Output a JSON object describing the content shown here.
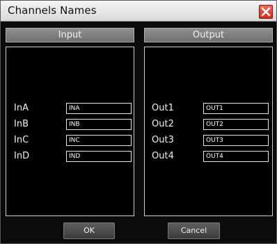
{
  "window": {
    "title": "Channels Names",
    "close_icon": "close-icon"
  },
  "input_panel": {
    "header": "Input",
    "rows": [
      {
        "label": "InA",
        "value": "INA"
      },
      {
        "label": "InB",
        "value": "INB"
      },
      {
        "label": "InC",
        "value": "INC"
      },
      {
        "label": "InD",
        "value": "IND"
      }
    ]
  },
  "output_panel": {
    "header": "Output",
    "rows": [
      {
        "label": "Out1",
        "value": "OUT1"
      },
      {
        "label": "Out2",
        "value": "OUT2"
      },
      {
        "label": "Out3",
        "value": "OUT3"
      },
      {
        "label": "Out4",
        "value": "OUT4"
      }
    ]
  },
  "buttons": {
    "ok": "OK",
    "cancel": "Cancel"
  },
  "colors": {
    "background": "#0b0b0b",
    "panel_header": "#7f7f7f",
    "close_button": "#d62b1f",
    "text": "#f0f0f0"
  }
}
